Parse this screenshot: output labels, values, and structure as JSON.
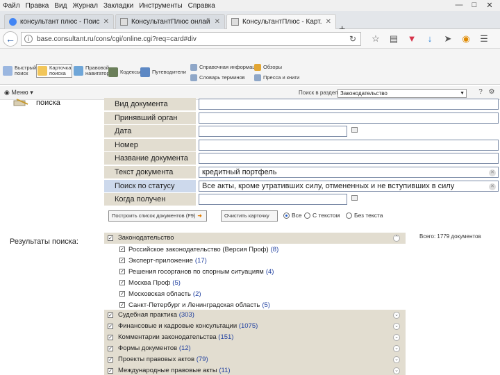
{
  "menubar": {
    "items": [
      "Файл",
      "Правка",
      "Вид",
      "Журнал",
      "Закладки",
      "Инструменты",
      "Справка"
    ]
  },
  "tabs": [
    {
      "label": "консультант плюс - Поис...",
      "favicon_color": "#4285f4"
    },
    {
      "label": "КонсультантПлюс онлайн...",
      "favicon_color": "#888888"
    },
    {
      "label": "КонсультантПлюс - Карт...",
      "favicon_color": "#888888"
    }
  ],
  "newtab": "+",
  "address": {
    "url": "base.consultant.ru/cons/cgi/online.cgi?req=card#div"
  },
  "toolbar": {
    "buttons": [
      {
        "line1": "Быстрый",
        "line2": "поиск"
      },
      {
        "line1": "Карточка",
        "line2": "поиска"
      },
      {
        "line1": "Правовой",
        "line2": "навигатор"
      },
      {
        "line1": "Кодексы",
        "line2": ""
      },
      {
        "line1": "Путеводители",
        "line2": ""
      }
    ],
    "right_items": [
      "Справочная информация",
      "Обзоры",
      "Словарь терминов",
      "Пресса и книги"
    ]
  },
  "subtoolbar": {
    "menu_label": "Меню",
    "section_label": "Поиск в разделе",
    "section_value": "Законодательство"
  },
  "card": {
    "title": "поиска",
    "fields": [
      {
        "label": "Вид документа",
        "value": ""
      },
      {
        "label": "Принявший орган",
        "value": ""
      },
      {
        "label": "Дата",
        "value": ""
      },
      {
        "label": "Номер",
        "value": ""
      },
      {
        "label": "Название документа",
        "value": ""
      },
      {
        "label": "Текст документа",
        "value": "кредитный портфель"
      },
      {
        "label": "Поиск по статусу",
        "value": "Все акты, кроме утративших силу, отмененных и не вступивших в силу"
      },
      {
        "label": "Когда получен",
        "value": ""
      }
    ]
  },
  "actions": {
    "build_list": "Построить список документов (F9)",
    "clear_card": "Очистить карточку",
    "radio_all": "Все",
    "radio_with_text": "С текстом",
    "radio_without_text": "Без текста"
  },
  "results": {
    "label": "Результаты поиска:",
    "total": "Всего: 1779 документов",
    "top_group": "Законодательство",
    "sub_items": [
      {
        "label": "Российское законодательство (Версия Проф)",
        "count": "(8)"
      },
      {
        "label": "Эксперт-приложение",
        "count": "(17)"
      },
      {
        "label": "Решения госорганов по спорным ситуациям",
        "count": "(4)"
      },
      {
        "label": "Москва Проф",
        "count": "(5)"
      },
      {
        "label": "Московская область",
        "count": "(2)"
      },
      {
        "label": "Санкт-Петербург и Ленинградская область",
        "count": "(5)"
      }
    ],
    "groups": [
      {
        "label": "Судебная практика",
        "count": "(303)"
      },
      {
        "label": "Финансовые и кадровые консультации",
        "count": "(1075)"
      },
      {
        "label": "Комментарии законодательства",
        "count": "(151)"
      },
      {
        "label": "Формы документов",
        "count": "(12)"
      },
      {
        "label": "Проекты правовых актов",
        "count": "(79)"
      },
      {
        "label": "Международные правовые акты",
        "count": "(11)"
      }
    ]
  }
}
